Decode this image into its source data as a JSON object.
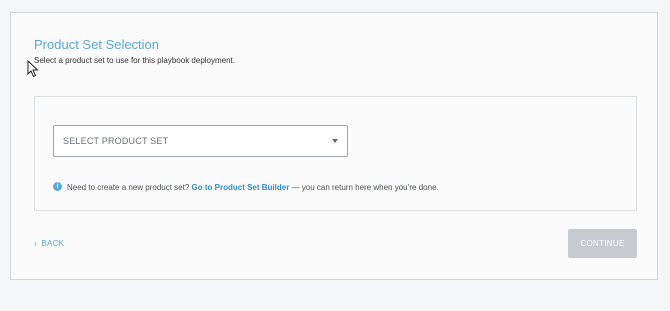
{
  "page": {
    "title": "Product Set Selection",
    "subtitle": "Select a product set to use for this playbook deployment."
  },
  "select": {
    "placeholder": "SELECT PRODUCT SET"
  },
  "info": {
    "icon": "info-icon",
    "prefix": "Need to create a new product set?",
    "link_text": "Go to Product Set Builder",
    "suffix": "— you can return here when you’re done."
  },
  "footer": {
    "back_label": "BACK",
    "continue_label": "CONTINUE",
    "continue_disabled": true
  },
  "colors": {
    "accent": "#5aa9d6",
    "link": "#2f8fc9",
    "button_disabled": "#c7cbcf"
  }
}
